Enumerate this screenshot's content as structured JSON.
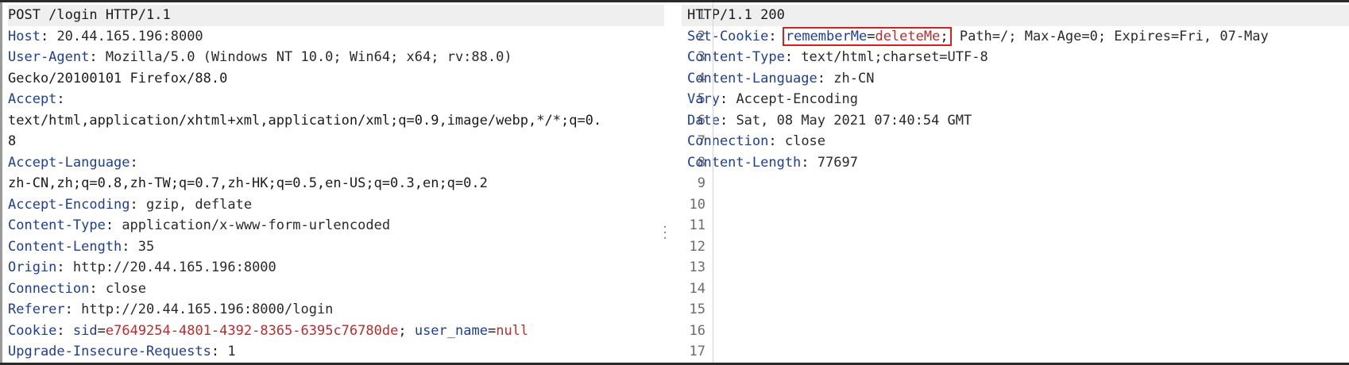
{
  "request": {
    "lines": [
      {
        "type": "plain",
        "text": "POST /login HTTP/1.1",
        "highlight": true
      },
      {
        "type": "header",
        "key": "Host",
        "value": "20.44.165.196:8000"
      },
      {
        "type": "header",
        "key": "User-Agent",
        "value": "Mozilla/5.0 (Windows NT 10.0; Win64; x64; rv:88.0)"
      },
      {
        "type": "plain",
        "text": "Gecko/20100101 Firefox/88.0"
      },
      {
        "type": "header",
        "key": "Accept",
        "value": ""
      },
      {
        "type": "plain",
        "text": "text/html,application/xhtml+xml,application/xml;q=0.9,image/webp,*/*;q=0."
      },
      {
        "type": "plain",
        "text": "8"
      },
      {
        "type": "header",
        "key": "Accept-Language",
        "value": ""
      },
      {
        "type": "plain",
        "text": "zh-CN,zh;q=0.8,zh-TW;q=0.7,zh-HK;q=0.5,en-US;q=0.3,en;q=0.2"
      },
      {
        "type": "header",
        "key": "Accept-Encoding",
        "value": "gzip, deflate"
      },
      {
        "type": "header",
        "key": "Content-Type",
        "value": "application/x-www-form-urlencoded"
      },
      {
        "type": "header",
        "key": "Content-Length",
        "value": "35"
      },
      {
        "type": "header",
        "key": "Origin",
        "value": "http://20.44.165.196:8000"
      },
      {
        "type": "header",
        "key": "Connection",
        "value": "close"
      },
      {
        "type": "header",
        "key": "Referer",
        "value": "http://20.44.165.196:8000/login"
      },
      {
        "type": "cookie",
        "key": "Cookie",
        "pairs": [
          {
            "name": "sid",
            "value": "e7649254-4801-4392-8365-6395c76780de"
          },
          {
            "name": "user_name",
            "value": "null"
          }
        ]
      },
      {
        "type": "header",
        "key": "Upgrade-Insecure-Requests",
        "value": "1"
      }
    ]
  },
  "response": {
    "line_numbers": [
      "1",
      "2",
      "3",
      "4",
      "5",
      "6",
      "7",
      "8",
      "9",
      "10",
      "11",
      "12",
      "13",
      "14",
      "15",
      "16",
      "17"
    ],
    "lines": [
      {
        "type": "plain",
        "text": "HTTP/1.1 200",
        "highlight": true
      },
      {
        "type": "setcookie",
        "key": "Set-Cookie",
        "cookie_name": "rememberMe",
        "cookie_value": "deleteMe",
        "rest": " Path=/; Max-Age=0; Expires=Fri, 07-May"
      },
      {
        "type": "header",
        "key": "Content-Type",
        "value": "text/html;charset=UTF-8"
      },
      {
        "type": "header",
        "key": "Content-Language",
        "value": "zh-CN"
      },
      {
        "type": "header",
        "key": "Vary",
        "value": "Accept-Encoding"
      },
      {
        "type": "header",
        "key": "Date",
        "value": "Sat, 08 May 2021 07:40:54 GMT"
      },
      {
        "type": "header",
        "key": "Connection",
        "value": "close"
      },
      {
        "type": "header",
        "key": "Content-Length",
        "value": "77697"
      },
      {
        "type": "empty"
      },
      {
        "type": "empty"
      },
      {
        "type": "empty"
      },
      {
        "type": "empty"
      },
      {
        "type": "empty"
      },
      {
        "type": "empty"
      },
      {
        "type": "empty"
      },
      {
        "type": "empty"
      },
      {
        "type": "empty"
      }
    ]
  },
  "colors": {
    "header_key": "#1f3f8f",
    "cookie_value": "#b23030",
    "highlight_box": "#d32020"
  }
}
